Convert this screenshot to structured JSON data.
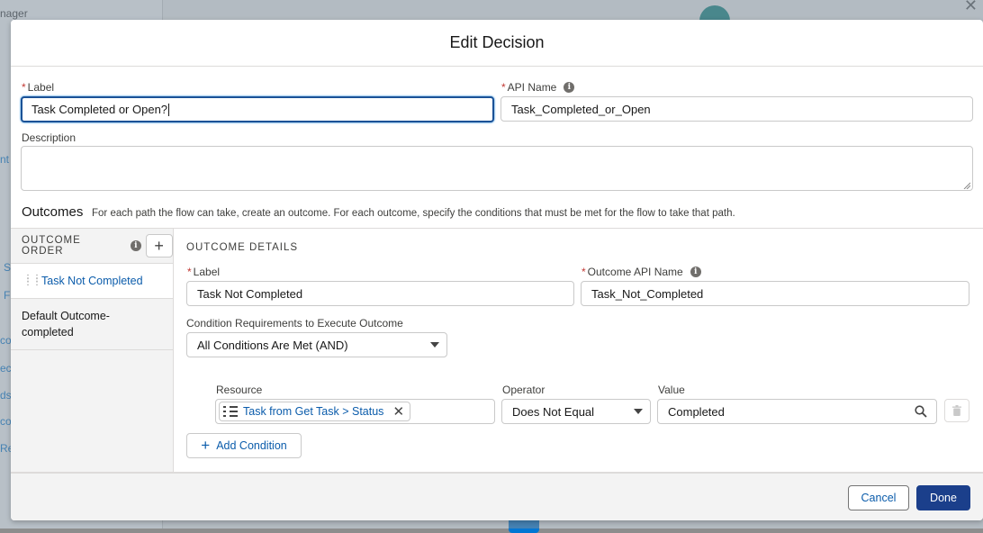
{
  "background": {
    "title_fragment": "nager",
    "sidebar_fragments": [
      "nt",
      "S",
      "Fi",
      "co",
      "ec",
      "ds",
      "co",
      "Re"
    ]
  },
  "modal": {
    "title": "Edit Decision",
    "label_field": {
      "label": "Label",
      "required_mark": "*",
      "value": "Task Completed or Open?"
    },
    "api_name_field": {
      "label": "API Name",
      "required_mark": "*",
      "value": "Task_Completed_or_Open"
    },
    "description_field": {
      "label": "Description",
      "value": ""
    },
    "outcomes": {
      "heading": "Outcomes",
      "help_text": "For each path the flow can take, create an outcome. For each outcome, specify the conditions that must be met for the flow to take that path.",
      "order_header": "OUTCOME ORDER",
      "items": [
        {
          "label": "Task Not Completed",
          "selected": true
        },
        {
          "label": "Default Outcome-\ncompleted",
          "selected": false
        }
      ]
    },
    "outcome_details": {
      "title": "OUTCOME DETAILS",
      "label_field": {
        "label": "Label",
        "required_mark": "*",
        "value": "Task Not Completed"
      },
      "api_name_field": {
        "label": "Outcome API Name",
        "required_mark": "*",
        "value": "Task_Not_Completed"
      },
      "condition_requirements": {
        "label": "Condition Requirements to Execute Outcome",
        "value": "All Conditions Are Met (AND)"
      },
      "condition": {
        "resource_label": "Resource",
        "resource_value": "Task from Get Task > Status",
        "operator_label": "Operator",
        "operator_value": "Does Not Equal",
        "value_label": "Value",
        "value_value": "Completed"
      },
      "add_condition_label": "Add Condition"
    },
    "footer": {
      "cancel_label": "Cancel",
      "done_label": "Done"
    }
  },
  "colors": {
    "brand": "#1b3f8b",
    "link": "#0b5cab",
    "required": "#c23934",
    "focus": "#1b5297"
  }
}
